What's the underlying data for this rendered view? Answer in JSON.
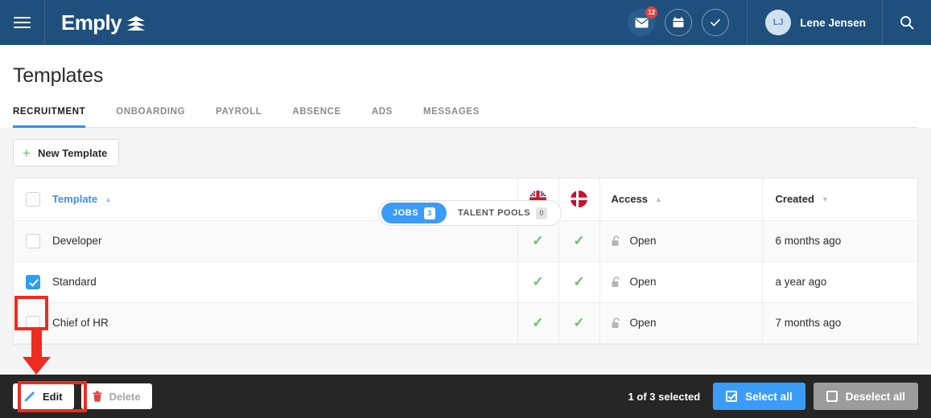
{
  "header": {
    "menu_icon": "hamburger-icon",
    "brand": "Emply",
    "brand_mark": "layers-icon",
    "mail_icon": "envelope-icon",
    "mail_badge": "12",
    "calendar_icon": "calendar-icon",
    "tasks_icon": "check-icon",
    "user_initials": "LJ",
    "user_name": "Lene Jensen",
    "search_icon": "search-icon",
    "bg_color": "#1e4f7d"
  },
  "page": {
    "title": "Templates",
    "tabs": [
      {
        "label": "RECRUITMENT",
        "active": true
      },
      {
        "label": "ONBOARDING",
        "active": false
      },
      {
        "label": "PAYROLL",
        "active": false
      },
      {
        "label": "ABSENCE",
        "active": false
      },
      {
        "label": "ADS",
        "active": false
      },
      {
        "label": "MESSAGES",
        "active": false
      }
    ]
  },
  "toolbar": {
    "new_template_label": "New Template",
    "plus_icon": "plus-icon",
    "segments": [
      {
        "label": "JOBS",
        "count": "3",
        "active": true
      },
      {
        "label": "TALENT POOLS",
        "count": "0",
        "active": false
      }
    ]
  },
  "table": {
    "columns": {
      "template": "Template",
      "flag_en": "uk-flag-icon",
      "flag_dk": "denmark-flag-icon",
      "access": "Access",
      "created": "Created"
    },
    "sort": {
      "active_column": "Template",
      "direction": "asc"
    },
    "rows": [
      {
        "name": "Developer",
        "checked": false,
        "en": "✓",
        "dk": "✓",
        "access": "Open",
        "access_icon": "unlock-icon",
        "created": "6 months ago"
      },
      {
        "name": "Standard",
        "checked": true,
        "en": "✓",
        "dk": "✓",
        "access": "Open",
        "access_icon": "unlock-icon",
        "created": "a year ago"
      },
      {
        "name": "Chief of HR",
        "checked": false,
        "en": "✓",
        "dk": "✓",
        "access": "Open",
        "access_icon": "unlock-icon",
        "created": "7 months ago"
      }
    ]
  },
  "actionbar": {
    "edit_label": "Edit",
    "edit_icon": "pencil-icon",
    "delete_label": "Delete",
    "delete_icon": "trash-icon",
    "selection_text": "1 of 3 selected",
    "select_all_label": "Select all",
    "deselect_all_label": "Deselect all",
    "accent_color": "#3b9cf7"
  },
  "annotations": {
    "highlight_color": "#ee2b21",
    "box_checkbox": "highlight-standard-checkbox",
    "box_edit": "highlight-edit-button",
    "arrow": "arrow-from-checkbox-to-edit"
  }
}
